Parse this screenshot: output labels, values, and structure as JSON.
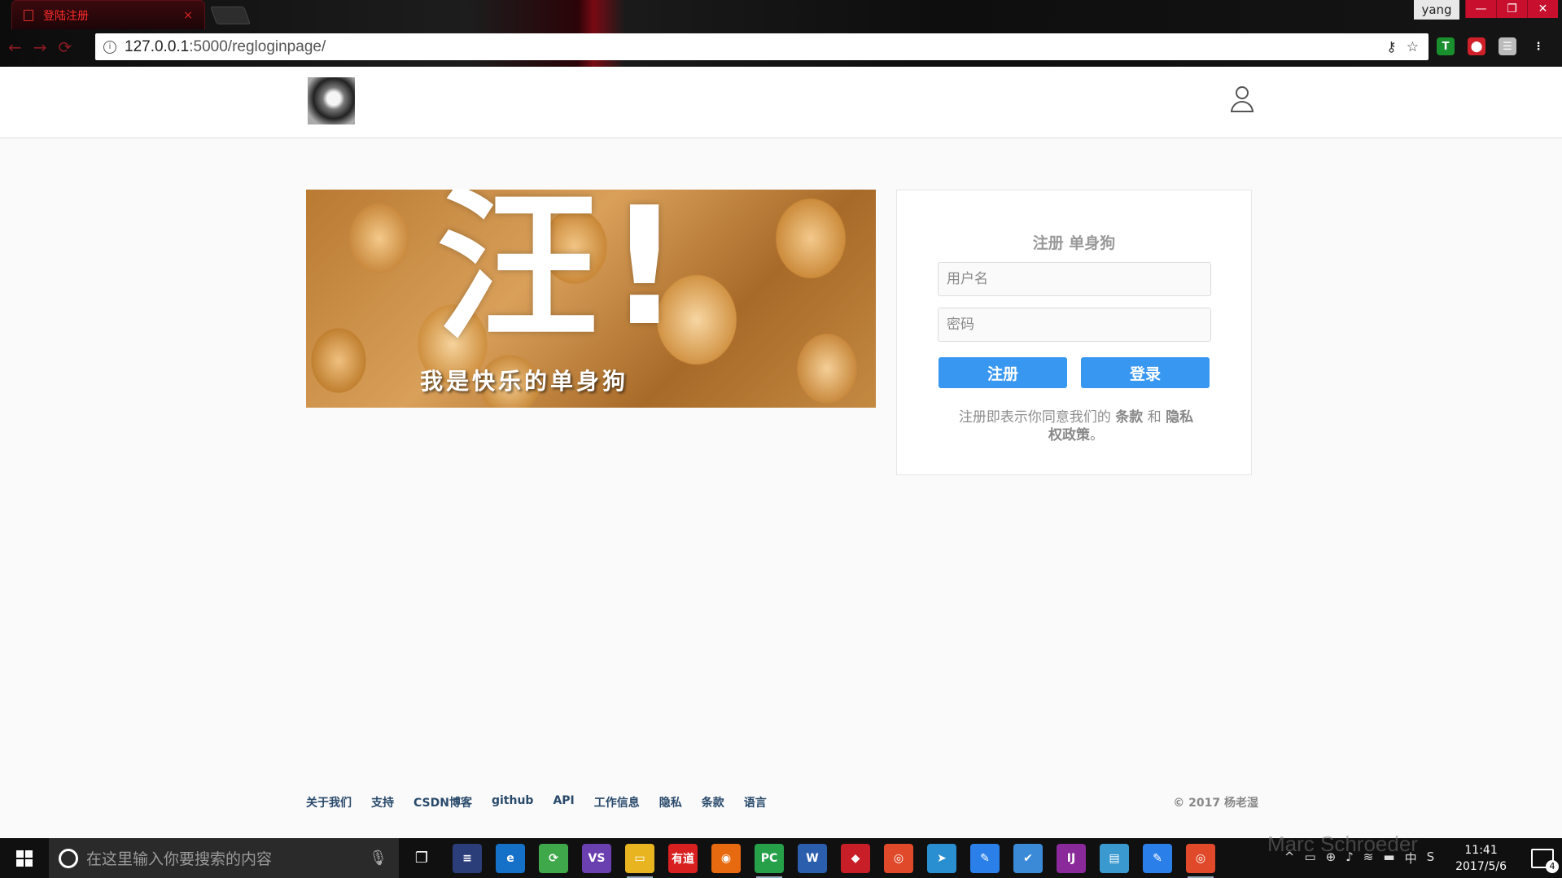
{
  "browser": {
    "tab_title": "登陆注册",
    "tab_close": "×",
    "profile_name": "yang",
    "window_minimize": "—",
    "window_restore": "❐",
    "window_close": "✕",
    "url_host": "127.0.0.1",
    "url_path": ":5000/regloginpage/",
    "back": "←",
    "forward": "→",
    "reload": "⟳",
    "key_icon": "⚷",
    "star_icon": "☆",
    "info_icon": "i",
    "extensions": [
      {
        "name": "T",
        "color": "#1a8f2e"
      },
      {
        "name": "⬤",
        "color": "#d0202a"
      },
      {
        "name": "☰",
        "color": "#bbbbbb"
      },
      {
        "name": "⋮",
        "color": "transparent"
      }
    ]
  },
  "header": {
    "logo_alt": "logo",
    "user_icon": "user-icon"
  },
  "banner": {
    "big_text": "汪!",
    "sub_text": "我是快乐的单身狗"
  },
  "register": {
    "title": "注册 单身狗",
    "username_placeholder": "用户名",
    "password_placeholder": "密码",
    "register_button": "注册",
    "login_button": "登录",
    "terms_prefix": "注册即表示你同意我们的",
    "terms_link": "条款",
    "terms_and": "和",
    "privacy_link": "隐私权政策",
    "terms_suffix": "。"
  },
  "footer": {
    "links": [
      "关于我们",
      "支持",
      "CSDN博客",
      "github",
      "API",
      "工作信息",
      "隐私",
      "条款",
      "语言"
    ],
    "copyright": "© 2017 杨老湿"
  },
  "taskbar": {
    "search_placeholder": "在这里输入你要搜索的内容",
    "mic_icon": "🎙",
    "task_view_icon": "❐",
    "apps": [
      {
        "label": "≡",
        "color": "#2c3e7a",
        "running": false
      },
      {
        "label": "e",
        "color": "#1570c8",
        "running": false
      },
      {
        "label": "⟳",
        "color": "#3fa84a",
        "running": false
      },
      {
        "label": "VS",
        "color": "#6a3fb0",
        "running": false
      },
      {
        "label": "▭",
        "color": "#e8b520",
        "running": true
      },
      {
        "label": "有道",
        "color": "#d82020",
        "running": false
      },
      {
        "label": "◉",
        "color": "#e86a10",
        "running": false
      },
      {
        "label": "PC",
        "color": "#27a04a",
        "running": true
      },
      {
        "label": "W",
        "color": "#2b5fae",
        "running": false
      },
      {
        "label": "◆",
        "color": "#c81e28",
        "running": false
      },
      {
        "label": "◎",
        "color": "#e04a2a",
        "running": false
      },
      {
        "label": "➤",
        "color": "#2a8fd0",
        "running": false
      },
      {
        "label": "✎",
        "color": "#2a7fe8",
        "running": false
      },
      {
        "label": "✔",
        "color": "#3a8ad8",
        "running": false
      },
      {
        "label": "IJ",
        "color": "#8a2a9a",
        "running": false
      },
      {
        "label": "▤",
        "color": "#3a9ad0",
        "running": false
      },
      {
        "label": "✎",
        "color": "#2a7fe8",
        "running": false
      },
      {
        "label": "◎",
        "color": "#e04a2a",
        "running": true
      }
    ],
    "tray_icons": [
      "^",
      "▭",
      "⊕",
      "♪",
      "≋",
      "▬",
      "中",
      "S"
    ],
    "time": "11:41",
    "date": "2017/5/6",
    "notification_count": "4",
    "watermark": "Marc Schroeder"
  }
}
